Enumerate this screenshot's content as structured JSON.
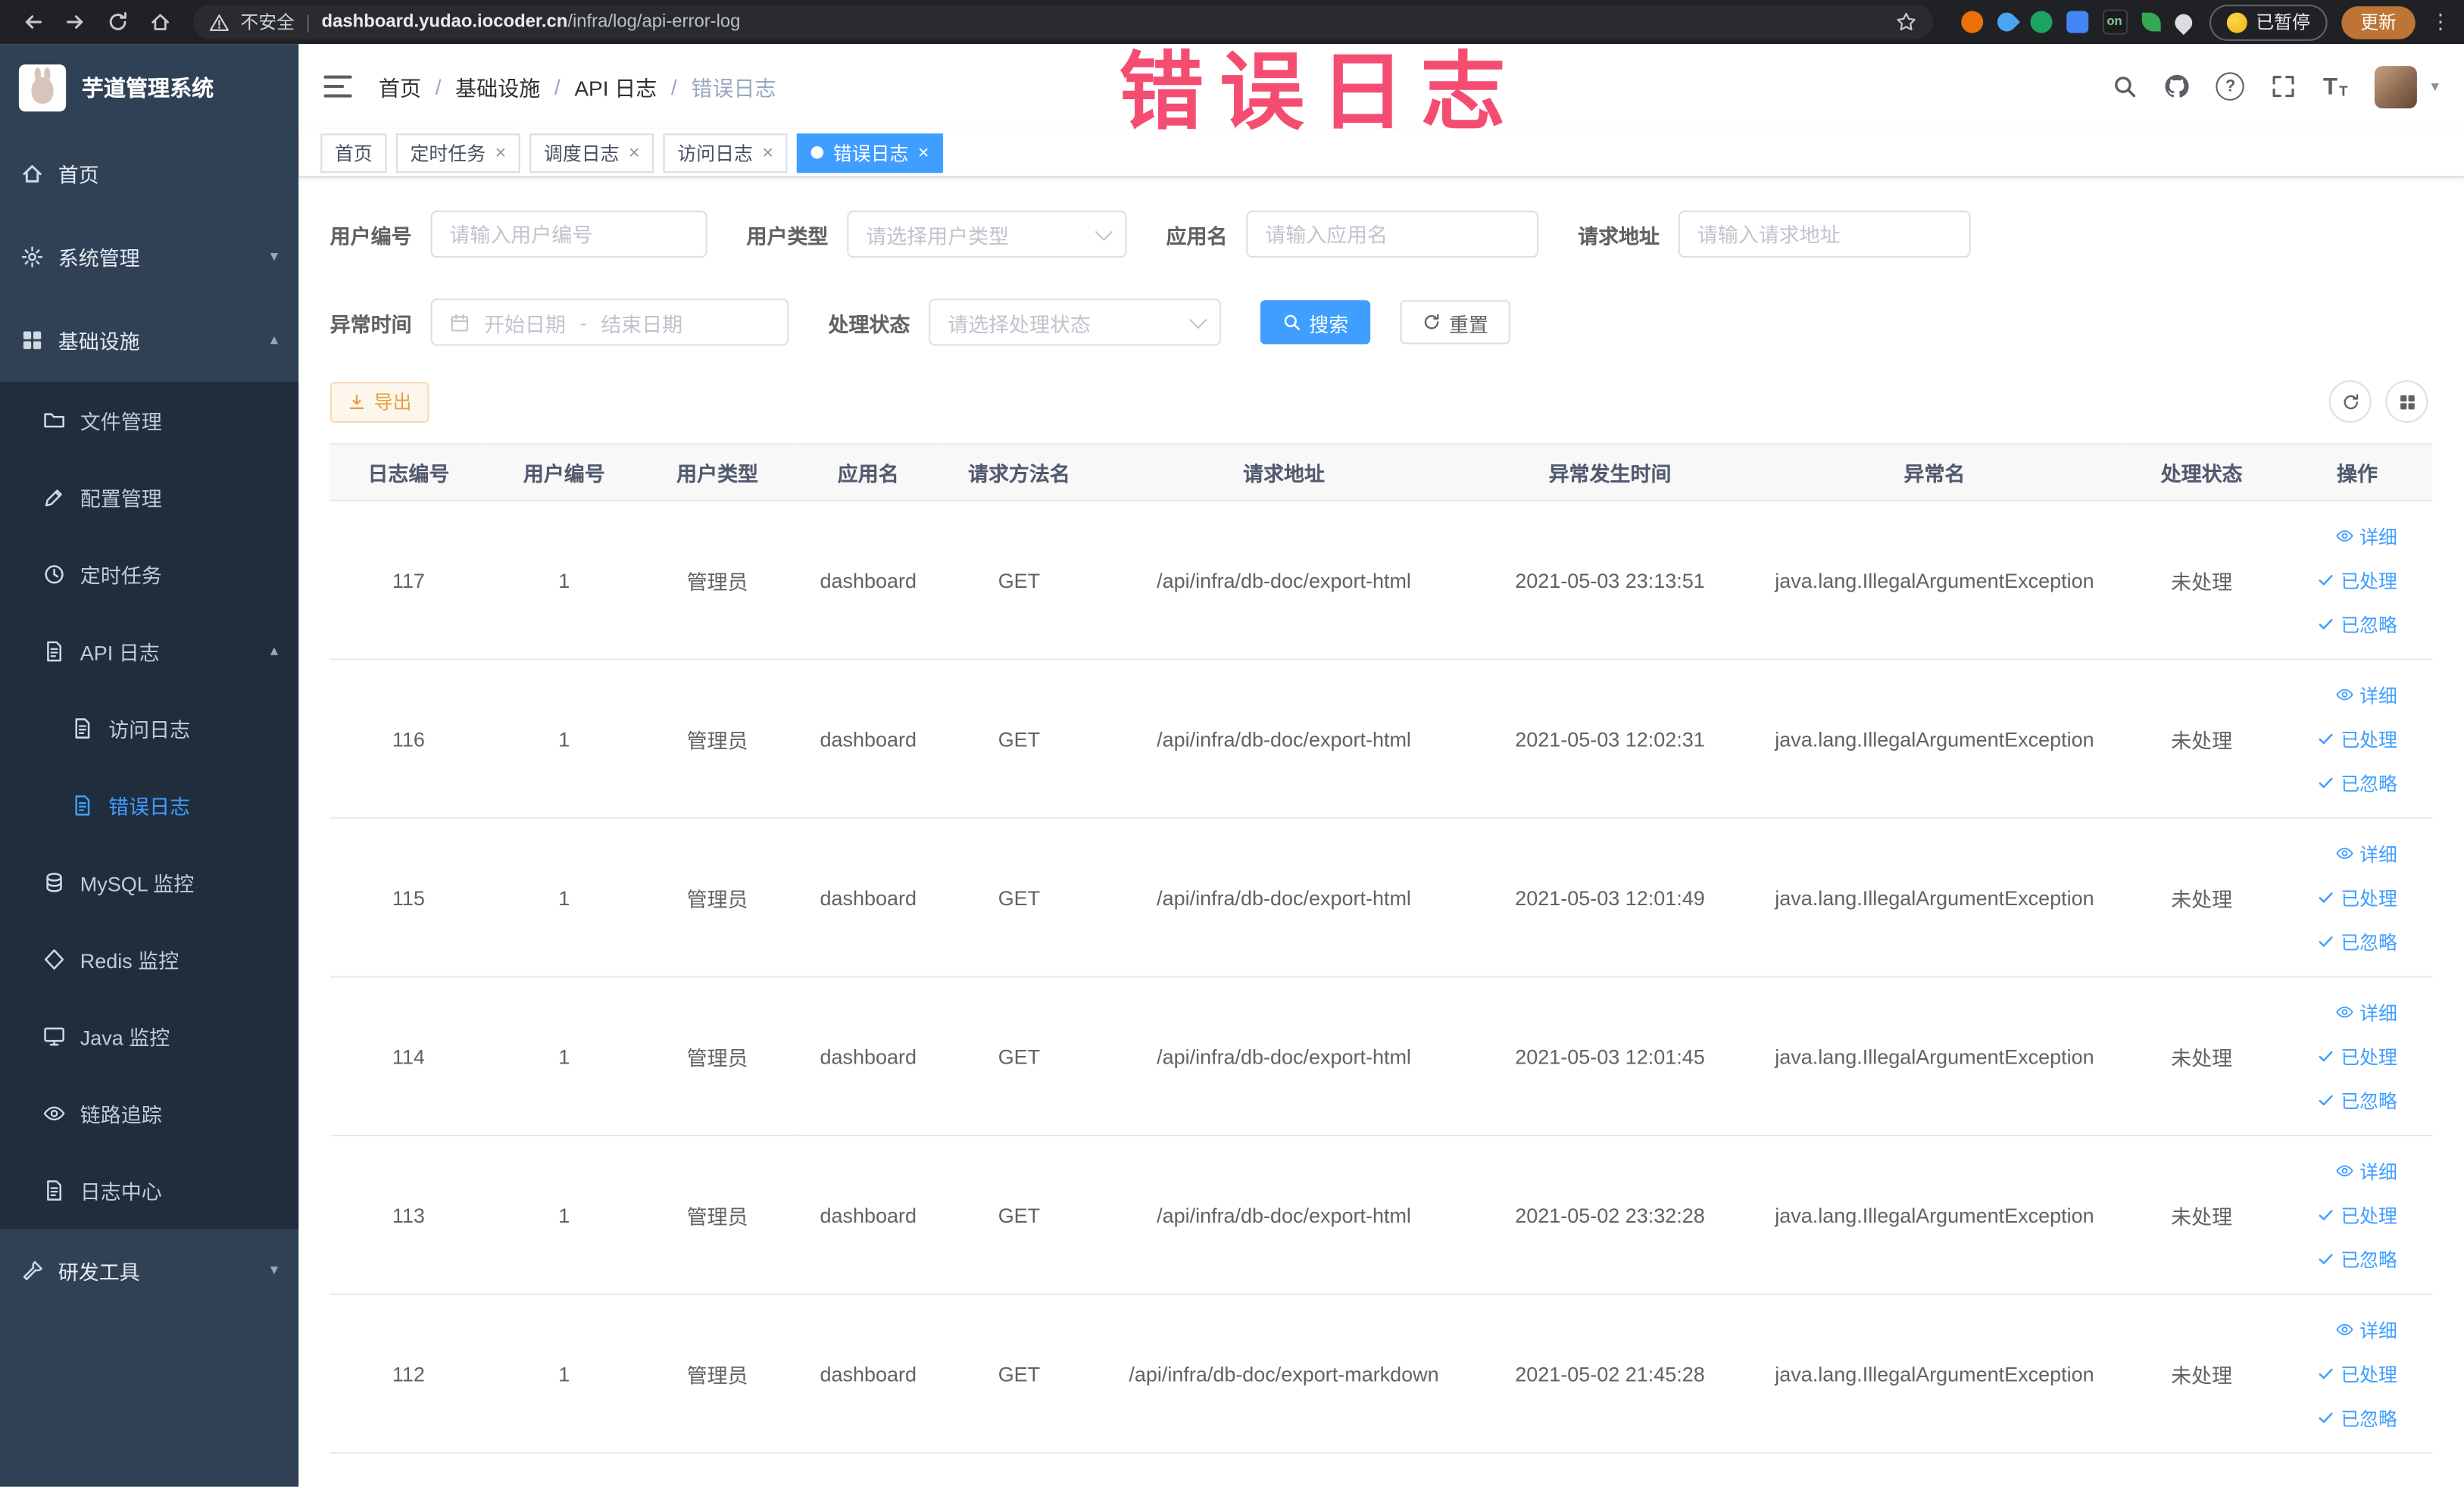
{
  "browser": {
    "security_label": "不安全",
    "url_domain": "dashboard.yudao.iocoder.cn",
    "url_path": "/infra/log/api-error-log",
    "paused_label": "已暂停",
    "update_label": "更新",
    "extension_badge": "on"
  },
  "icons": {
    "close": "×",
    "chevron_down": "▾",
    "chevron_up": "▴",
    "caret_down": "▾",
    "kebab": "⋮",
    "breadcrumb_separator": "/",
    "divider": "|",
    "question": "?",
    "font_size": "T"
  },
  "annotation": {
    "text": "错误日志"
  },
  "sidebar": {
    "logo_title": "芋道管理系统",
    "home": "首页",
    "system_mgmt": "系统管理",
    "infrastructure": "基础设施",
    "file_mgmt": "文件管理",
    "config_mgmt": "配置管理",
    "scheduled_jobs": "定时任务",
    "api_log": "API 日志",
    "access_log": "访问日志",
    "error_log": "错误日志",
    "mysql_monitor": "MySQL 监控",
    "redis_monitor": "Redis 监控",
    "java_monitor": "Java 监控",
    "trace": "链路追踪",
    "log_center": "日志中心",
    "dev_tools": "研发工具"
  },
  "header": {
    "breadcrumb": [
      "首页",
      "基础设施",
      "API 日志",
      "错误日志"
    ]
  },
  "tabs": [
    {
      "label": "首页"
    },
    {
      "label": "定时任务"
    },
    {
      "label": "调度日志"
    },
    {
      "label": "访问日志"
    },
    {
      "label": "错误日志"
    }
  ],
  "filters": {
    "user_id_label": "用户编号",
    "user_id_placeholder": "请输入用户编号",
    "user_type_label": "用户类型",
    "user_type_placeholder": "请选择用户类型",
    "app_name_label": "应用名",
    "app_name_placeholder": "请输入应用名",
    "request_url_label": "请求地址",
    "request_url_placeholder": "请输入请求地址",
    "exception_time_label": "异常时间",
    "date_start_placeholder": "开始日期",
    "date_separator": "-",
    "date_end_placeholder": "结束日期",
    "status_label": "处理状态",
    "status_placeholder": "请选择处理状态",
    "search_label": "搜索",
    "reset_label": "重置"
  },
  "toolbar": {
    "export_label": "导出"
  },
  "table": {
    "columns": [
      "日志编号",
      "用户编号",
      "用户类型",
      "应用名",
      "请求方法名",
      "请求地址",
      "异常发生时间",
      "异常名",
      "处理状态",
      "操作"
    ],
    "actions": {
      "detail": "详细",
      "processed": "已处理",
      "ignored": "已忽略"
    },
    "rows": [
      {
        "log_id": "117",
        "user_id": "1",
        "user_type": "管理员",
        "app_name": "dashboard",
        "method": "GET",
        "url": "/api/infra/db-doc/export-html",
        "time": "2021-05-03 23:13:51",
        "exception": "java.lang.IllegalArgumentException",
        "status": "未处理"
      },
      {
        "log_id": "116",
        "user_id": "1",
        "user_type": "管理员",
        "app_name": "dashboard",
        "method": "GET",
        "url": "/api/infra/db-doc/export-html",
        "time": "2021-05-03 12:02:31",
        "exception": "java.lang.IllegalArgumentException",
        "status": "未处理"
      },
      {
        "log_id": "115",
        "user_id": "1",
        "user_type": "管理员",
        "app_name": "dashboard",
        "method": "GET",
        "url": "/api/infra/db-doc/export-html",
        "time": "2021-05-03 12:01:49",
        "exception": "java.lang.IllegalArgumentException",
        "status": "未处理"
      },
      {
        "log_id": "114",
        "user_id": "1",
        "user_type": "管理员",
        "app_name": "dashboard",
        "method": "GET",
        "url": "/api/infra/db-doc/export-html",
        "time": "2021-05-03 12:01:45",
        "exception": "java.lang.IllegalArgumentException",
        "status": "未处理"
      },
      {
        "log_id": "113",
        "user_id": "1",
        "user_type": "管理员",
        "app_name": "dashboard",
        "method": "GET",
        "url": "/api/infra/db-doc/export-html",
        "time": "2021-05-02 23:32:28",
        "exception": "java.lang.IllegalArgumentException",
        "status": "未处理"
      },
      {
        "log_id": "112",
        "user_id": "1",
        "user_type": "管理员",
        "app_name": "dashboard",
        "method": "GET",
        "url": "/api/infra/db-doc/export-markdown",
        "time": "2021-05-02 21:45:28",
        "exception": "java.lang.IllegalArgumentException",
        "status": "未处理"
      }
    ]
  }
}
